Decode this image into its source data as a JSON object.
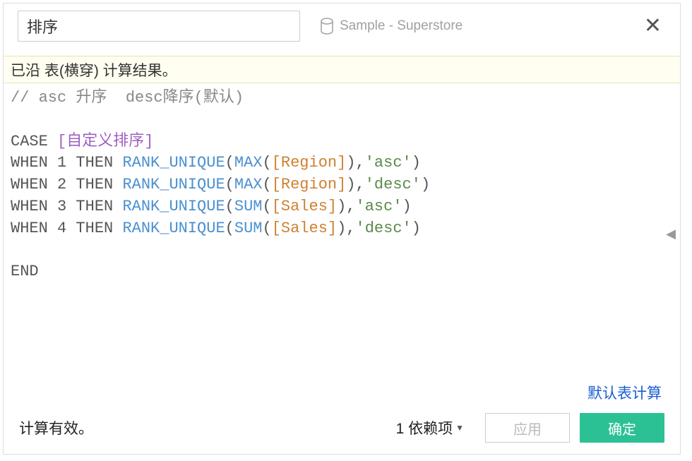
{
  "header": {
    "name_value": "排序",
    "datasource": "Sample - Superstore"
  },
  "banner": "已沿 表(横穿) 计算结果。",
  "code": {
    "comment": "// asc 升序  desc降序(默认)",
    "case_kw": "CASE",
    "field": "[自定义排序]",
    "lines": [
      {
        "when": "WHEN",
        "n": "1",
        "then": "THEN",
        "func": "RANK_UNIQUE",
        "agg": "MAX",
        "param": "[Region]",
        "str": "'asc'"
      },
      {
        "when": "WHEN",
        "n": "2",
        "then": "THEN",
        "func": "RANK_UNIQUE",
        "agg": "MAX",
        "param": "[Region]",
        "str": "'desc'"
      },
      {
        "when": "WHEN",
        "n": "3",
        "then": "THEN",
        "func": "RANK_UNIQUE",
        "agg": "SUM",
        "param": "[Sales]",
        "str": "'asc'"
      },
      {
        "when": "WHEN",
        "n": "4",
        "then": "THEN",
        "func": "RANK_UNIQUE",
        "agg": "SUM",
        "param": "[Sales]",
        "str": "'desc'"
      }
    ],
    "end_kw": "END"
  },
  "link": "默认表计算",
  "footer": {
    "status": "计算有效。",
    "deps": "1 依赖项",
    "apply": "应用",
    "ok": "确定"
  }
}
